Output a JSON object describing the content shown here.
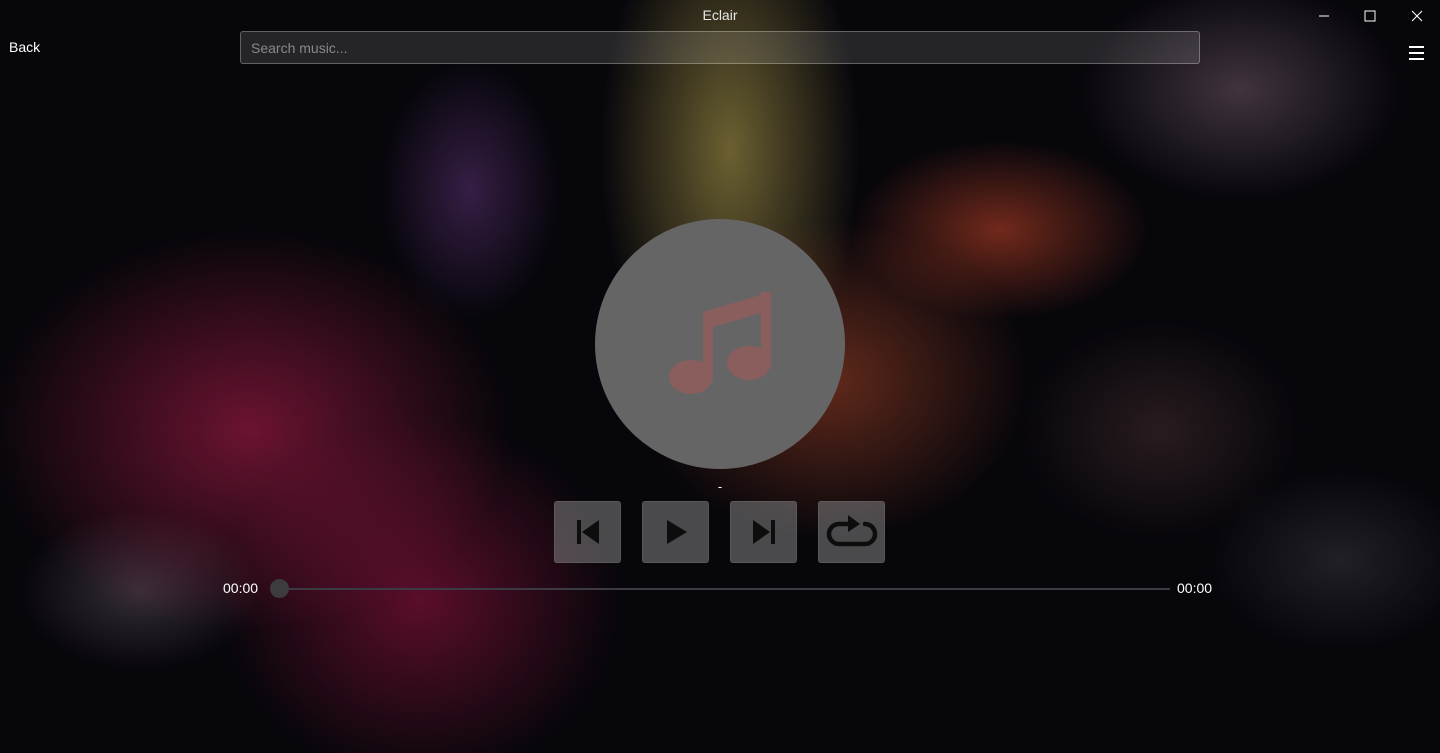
{
  "window": {
    "title": "Eclair",
    "controls": [
      "minimize",
      "maximize",
      "close"
    ]
  },
  "header": {
    "back_label": "Back",
    "search": {
      "placeholder": "Search music...",
      "value": ""
    },
    "menu_icon": "hamburger-menu-icon"
  },
  "player": {
    "album_icon": "music-note-icon",
    "track_title": "-",
    "controls": [
      {
        "name": "previous",
        "icon": "skip-previous-icon"
      },
      {
        "name": "play",
        "icon": "play-icon"
      },
      {
        "name": "next",
        "icon": "skip-next-icon"
      },
      {
        "name": "repeat",
        "icon": "repeat-icon"
      }
    ],
    "current_time": "00:00",
    "total_time": "00:00",
    "progress": 0
  },
  "colors": {
    "album_circle": "#666566",
    "music_note": "#8a5e5c",
    "control_button": "#828282",
    "seek_thumb": "#3c3c3e"
  }
}
